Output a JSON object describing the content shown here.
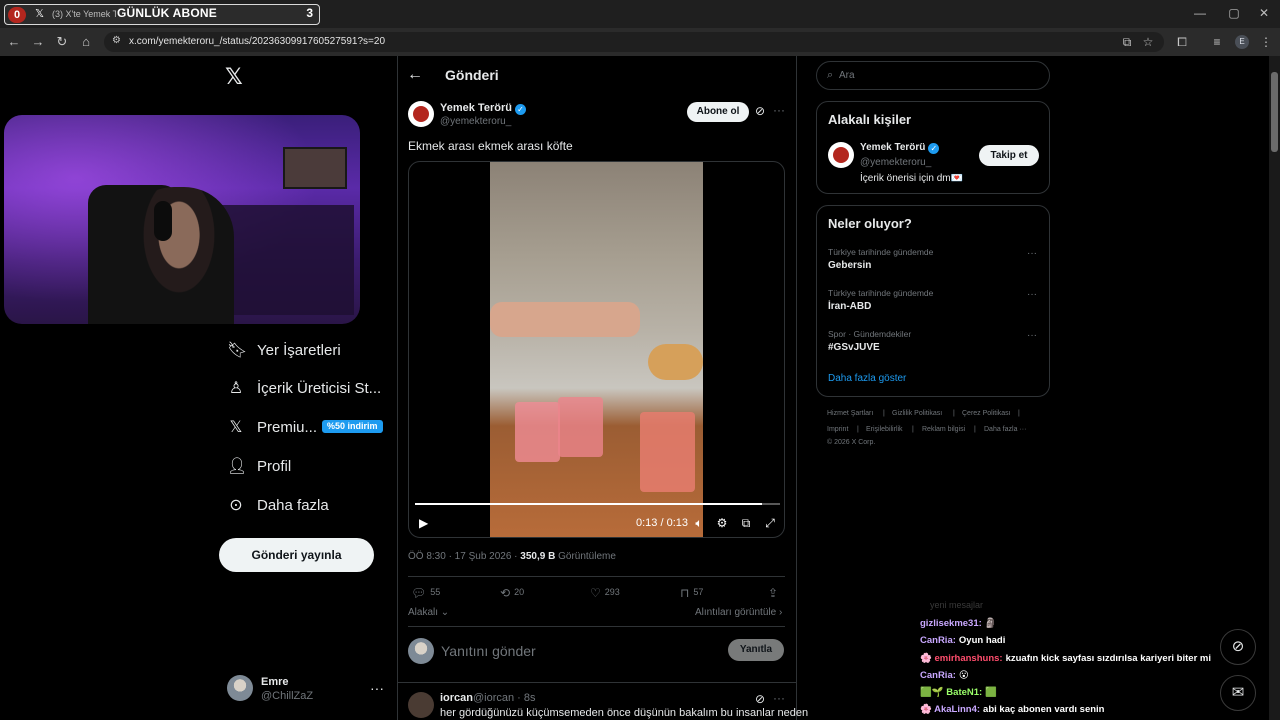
{
  "browser": {
    "tab_counter_left": "0",
    "tab_title": "(3) X'te Yemek Terör",
    "tab_overlay": "GÜNLÜK ABONE",
    "tab_counter_right": "3",
    "url": "x.com/yemekteroru_/status/2023630991760527591?s=20",
    "profile_initial": "E"
  },
  "nav": {
    "items": [
      {
        "label": "Yer İşaretleri"
      },
      {
        "label": "İçerik Üreticisi St..."
      },
      {
        "label": "Premiu...",
        "badge": "%50 indirim"
      },
      {
        "label": "Profil"
      },
      {
        "label": "Daha fazla"
      }
    ],
    "post_button": "Gönderi yayınla",
    "user": {
      "name": "Emre",
      "handle": "@ChillZaZ"
    }
  },
  "header": {
    "title": "Gönderi"
  },
  "post": {
    "author_name": "Yemek Terörü",
    "author_handle": "@yemekteroru_",
    "subscribe_label": "Abone ol",
    "text": "Ekmek arası ekmek arası köfte",
    "video": {
      "time": "0:13 / 0:13",
      "progress": 0.95
    },
    "timestamp": "ÖÖ 8:30 · 17 Şub 2026 · ",
    "views_count": "350,9 B",
    "views_label": " Görüntüleme",
    "stats": {
      "replies": "55",
      "reposts": "20",
      "likes": "293",
      "bookmarks": "57"
    },
    "related_left": "Alakalı",
    "related_right": "Alıntıları görüntüle",
    "reply_placeholder": "Yanıtını gönder",
    "reply_button": "Yanıtla"
  },
  "reply": {
    "name": "iorcan",
    "meta": "@iorcan · 8s",
    "text": "her gördüğünüzü küçümsemeden önce düşünün bakalım bu insanlar neden"
  },
  "search": {
    "placeholder": "Ara"
  },
  "related_people": {
    "title": "Alakalı kişiler",
    "name": "Yemek Terörü",
    "handle": "@yemekteroru_",
    "bio": "İçerik önerisi için dm💌",
    "follow_label": "Takip et"
  },
  "trends": {
    "title": "Neler oluyor?",
    "items": [
      {
        "category": "Türkiye tarihinde gündemde",
        "name": "Gebersin"
      },
      {
        "category": "Türkiye tarihinde gündemde",
        "name": "İran-ABD"
      },
      {
        "category": "Spor · Gündemdekiler",
        "name": "#GSvJUVE"
      }
    ],
    "show_more": "Daha fazla göster"
  },
  "footer": {
    "links": [
      "Hizmet Şartları",
      "|",
      "Gizlilik Politikası",
      "|",
      "Çerez Politikası",
      "|",
      "Imprint",
      "|",
      "Erişilebilirlik",
      "|",
      "Reklam bilgisi",
      "|",
      "Daha fazla ···"
    ],
    "copyright": "© 2026 X Corp."
  },
  "chat": {
    "faded": "yeni mesajlar",
    "lines": [
      {
        "name": "gizlisekme31:",
        "text": "🗿",
        "color": "#c9a8ff"
      },
      {
        "name": "CanRia:",
        "text": "Oyun hadi",
        "color": "#c9a8ff"
      },
      {
        "name": "🌸 emirhanshuns:",
        "text": "kzuafın kick sayfası sızdırılsa kariyeri biter mi",
        "color": "#ff4d6d"
      },
      {
        "name": "CanRia:",
        "text": "😮",
        "color": "#c9a8ff"
      },
      {
        "name": "🟩🌱 BateN1:",
        "text": "🟩",
        "color": "#9bff6a"
      },
      {
        "name": "🌸 AkaLinn4:",
        "text": "abi kaç abonen vardı senin",
        "color": "#c9a8ff"
      }
    ]
  },
  "colors": {
    "accent": "#1d9bf0",
    "background": "#000000",
    "border": "#2f3336",
    "muted": "#71767b"
  }
}
